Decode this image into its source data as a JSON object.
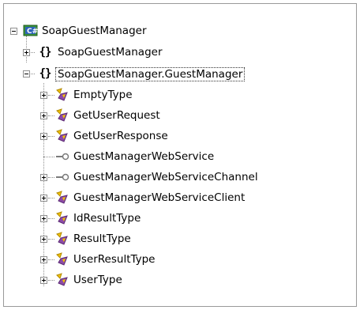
{
  "tree": {
    "root": {
      "label": "SoapGuestManager",
      "icon": "project-icon"
    },
    "namespaces": [
      {
        "label": "SoapGuestManager",
        "icon": "namespace-icon",
        "expanded": false
      },
      {
        "label": "SoapGuestManager.GuestManager",
        "icon": "namespace-icon",
        "expanded": true,
        "selected": true
      }
    ],
    "items": [
      {
        "label": "EmptyType",
        "icon": "class-icon"
      },
      {
        "label": "GetUserRequest",
        "icon": "class-icon"
      },
      {
        "label": "GetUserResponse",
        "icon": "class-icon"
      },
      {
        "label": "GuestManagerWebService",
        "icon": "interface-icon"
      },
      {
        "label": "GuestManagerWebServiceChannel",
        "icon": "interface-icon"
      },
      {
        "label": "GuestManagerWebServiceClient",
        "icon": "class-icon"
      },
      {
        "label": "IdResultType",
        "icon": "class-icon"
      },
      {
        "label": "ResultType",
        "icon": "class-icon"
      },
      {
        "label": "UserResultType",
        "icon": "class-icon"
      },
      {
        "label": "UserType",
        "icon": "class-icon"
      }
    ]
  },
  "colors": {
    "class_yellow": "#f2c200",
    "class_purple": "#8c4aa8",
    "interface_gray": "#7a7a7a",
    "project_green": "#3a8f3a",
    "project_blue": "#2d63b8"
  }
}
